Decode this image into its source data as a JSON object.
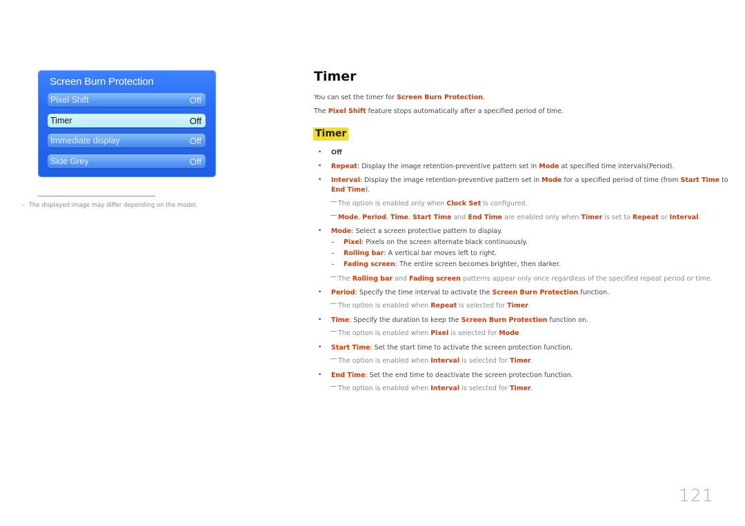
{
  "osd": {
    "title": "Screen Burn Protection",
    "items": [
      {
        "label": "Pixel Shift",
        "value": "Off"
      },
      {
        "label": "Timer",
        "value": "Off"
      },
      {
        "label": "Immediate display",
        "value": "Off"
      },
      {
        "label": "Side Grey",
        "value": "Off"
      }
    ],
    "selected_index": 1
  },
  "footnote": "The displayed image may differ depending on the model.",
  "section": {
    "title": "Timer",
    "intro1": [
      "You can set the timer for ",
      "Screen Burn Protection",
      "."
    ],
    "intro2": [
      "The ",
      "Pixel Shift",
      " feature stops automatically after a specified period of time."
    ],
    "subheading": "Timer"
  },
  "content": {
    "off": "Off",
    "repeat": [
      "Repeat",
      ": Display the image retention-preventive pattern set in ",
      "Mode",
      " at specified time intervals(Period)."
    ],
    "interval": [
      "Interval",
      ": Display the image retention-preventive pattern set in ",
      "Mode",
      " for a specified period of time (from ",
      "Start Time",
      " to"
    ],
    "interval2": [
      "End Time",
      ")."
    ],
    "note1": [
      "The option is enabled only when ",
      "Clock Set",
      " is configured."
    ],
    "note2": [
      "Mode",
      ", ",
      "Period",
      ", ",
      "Time",
      ", ",
      "Start Time",
      " and ",
      "End Time",
      " are enabled only when ",
      "Timer",
      " is set to ",
      "Repeat",
      " or ",
      "Interval",
      "."
    ],
    "mode": [
      "Mode",
      ": Select a screen protective pattern to display."
    ],
    "mode_pixel": [
      "Pixel",
      ": Pixels on the screen alternate black continuously."
    ],
    "mode_rolling": [
      "Rolling bar",
      ": A vertical bar moves left to right."
    ],
    "mode_fading": [
      "Fading screen",
      ": The entire screen becomes brighter, then darker."
    ],
    "note3": [
      "The ",
      "Rolling bar",
      " and ",
      "Fading screen",
      " patterns appear only once regardless of the specified repeat period or time."
    ],
    "period": [
      "Period",
      ": Specify the time interval to activate the ",
      "Screen Burn Protection",
      " function."
    ],
    "note4": [
      "The option is enabled when ",
      "Repeat",
      " is selected for ",
      "Timer",
      "."
    ],
    "time": [
      "Time",
      ": Specify the duration to keep the ",
      "Screen Burn Protection",
      " function on."
    ],
    "note5": [
      "The option is enabled when ",
      "Pixel",
      " is selected for ",
      "Mode",
      "."
    ],
    "start": [
      "Start Time",
      ": Set the start time to activate the screen protection function."
    ],
    "note6": [
      "The option is enabled when ",
      "Interval",
      " is selected for ",
      "Timer",
      "."
    ],
    "end": [
      "End Time",
      ": Set the end time to deactivate the screen protection function."
    ],
    "note7": [
      "The option is enabled when ",
      "Interval",
      " is selected for ",
      "Timer",
      "."
    ]
  },
  "symbols": {
    "bullet": "•",
    "dash": "–",
    "footnote_dash": "–"
  },
  "page_number": "121"
}
